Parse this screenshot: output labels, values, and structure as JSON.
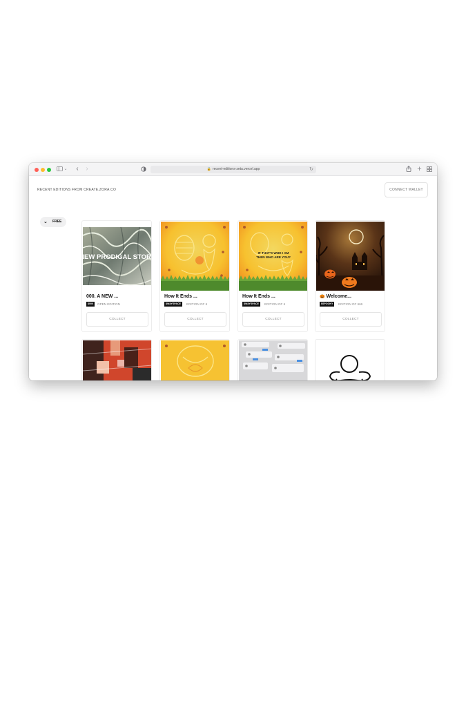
{
  "browser": {
    "url": "recent-editions-zeta.vercel.app",
    "icons": [
      "sidebar-icon",
      "chevron-down-icon",
      "back-icon",
      "forward-icon",
      "shield-icon",
      "lock-icon",
      "reload-icon",
      "share-icon",
      "new-tab-icon",
      "tab-overview-icon"
    ]
  },
  "page": {
    "title": "RECENT EDITIONS FROM CREATE.ZORA.CO",
    "connect_label": "CONNECT WALLET",
    "filter_label": "FREE"
  },
  "cards": [
    {
      "title": "000. A NEW ...",
      "badge": "$000",
      "edition": "OPEN EDITION",
      "collect": "COLLECT",
      "art_text": "NEW PRODIGAL STORY"
    },
    {
      "title": "How It Ends ...",
      "badge": "$WAYSPACE",
      "edition": "EDITION OF 6",
      "collect": "COLLECT"
    },
    {
      "title": "How It Ends ...",
      "badge": "$WAYSPACE",
      "edition": "EDITION OF 6",
      "collect": "COLLECT",
      "art_text_1": "IF THAT'S WHO I AM",
      "art_text_2": "THEN WHO ARE YOU?"
    },
    {
      "title": "Welcome...",
      "badge": "$SPOOKY",
      "edition": "EDITION OF 666",
      "collect": "COLLECT",
      "emoji": "🎃"
    }
  ],
  "colors": {
    "accent": "#111111",
    "muted": "#8a8a8a",
    "yellow": "#f7c737"
  }
}
